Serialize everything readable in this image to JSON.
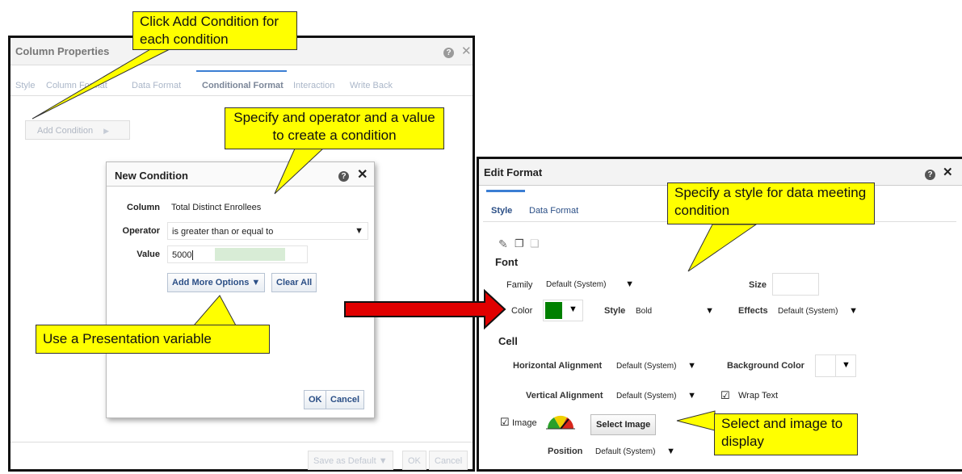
{
  "column_properties": {
    "title": "Column Properties",
    "tabs": [
      {
        "label": "Style",
        "active": false
      },
      {
        "label": "Column Format",
        "active": false
      },
      {
        "label": "Data Format",
        "active": false
      },
      {
        "label": "Conditional Format",
        "active": true
      },
      {
        "label": "Interaction",
        "active": false
      },
      {
        "label": "Write Back",
        "active": false
      }
    ],
    "add_condition_label": "Add Condition",
    "footer": {
      "save_default": "Save as Default ▼",
      "ok": "OK",
      "cancel": "Cancel"
    }
  },
  "new_condition": {
    "title": "New Condition",
    "column_label": "Column",
    "column_value": "Total Distinct Enrollees",
    "operator_label": "Operator",
    "operator_value": "is greater than or equal to",
    "value_label": "Value",
    "value_value": "5000",
    "add_more_options": "Add More Options ▼",
    "clear_all": "Clear All",
    "ok": "OK",
    "cancel": "Cancel"
  },
  "edit_format": {
    "title": "Edit Format",
    "tabs": [
      {
        "label": "Style",
        "active": true
      },
      {
        "label": "Data Format",
        "active": false
      }
    ],
    "font_section": "Font",
    "family_label": "Family",
    "family_value": "Default (System)",
    "size_label": "Size",
    "color_label": "Color",
    "font_color": "#008000",
    "style_label": "Style",
    "style_value": "Bold",
    "effects_label": "Effects",
    "effects_value": "Default (System)",
    "cell_section": "Cell",
    "h_align_label": "Horizontal Alignment",
    "h_align_value": "Default (System)",
    "bg_color_label": "Background Color",
    "v_align_label": "Vertical Alignment",
    "v_align_value": "Default (System)",
    "wrap_text_label": "Wrap Text",
    "wrap_text_checked": true,
    "image_label": "Image",
    "image_checked": true,
    "select_image": "Select Image",
    "position_label": "Position",
    "position_value": "Default (System)"
  },
  "callouts": {
    "add_condition": "Click Add Condition for each condition",
    "operator_value": "Specify and operator and a value to create a condition",
    "presentation_variable": "Use a Presentation variable",
    "style": "Specify a style for data meeting condition",
    "select_image": "Select and image to display"
  },
  "colors": {
    "callout_bg": "#ffff00",
    "arrow_red": "#e00000",
    "accent_blue": "#3b7ed3",
    "link_blue": "#2b4f86"
  },
  "icons": [
    "help-icon",
    "close-icon",
    "chevron-right-icon",
    "dropdown-arrow-icon",
    "brush-icon",
    "copy-icon",
    "paste-icon",
    "checkbox-icon",
    "gauge-image-icon"
  ]
}
